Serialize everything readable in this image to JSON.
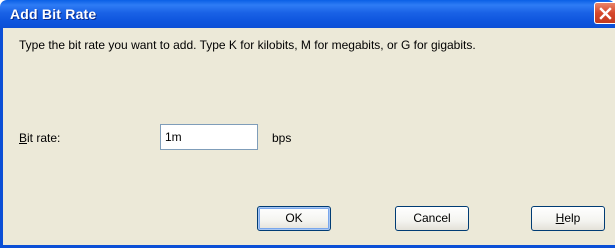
{
  "window": {
    "title": "Add Bit Rate"
  },
  "description": "Type the bit rate you want to add. Type K for kilobits, M for megabits, or G for gigabits.",
  "bit_rate": {
    "label_accel": "B",
    "label_rest": "it rate:",
    "value": "1m",
    "unit": "bps"
  },
  "buttons": {
    "ok": "OK",
    "cancel": "Cancel",
    "help_accel": "H",
    "help_rest": "elp"
  },
  "icons": {
    "close": "close-icon"
  },
  "colors": {
    "titlebar": "#0b4fd6",
    "close": "#d6482c",
    "dialog_bg": "#ece9d8"
  }
}
